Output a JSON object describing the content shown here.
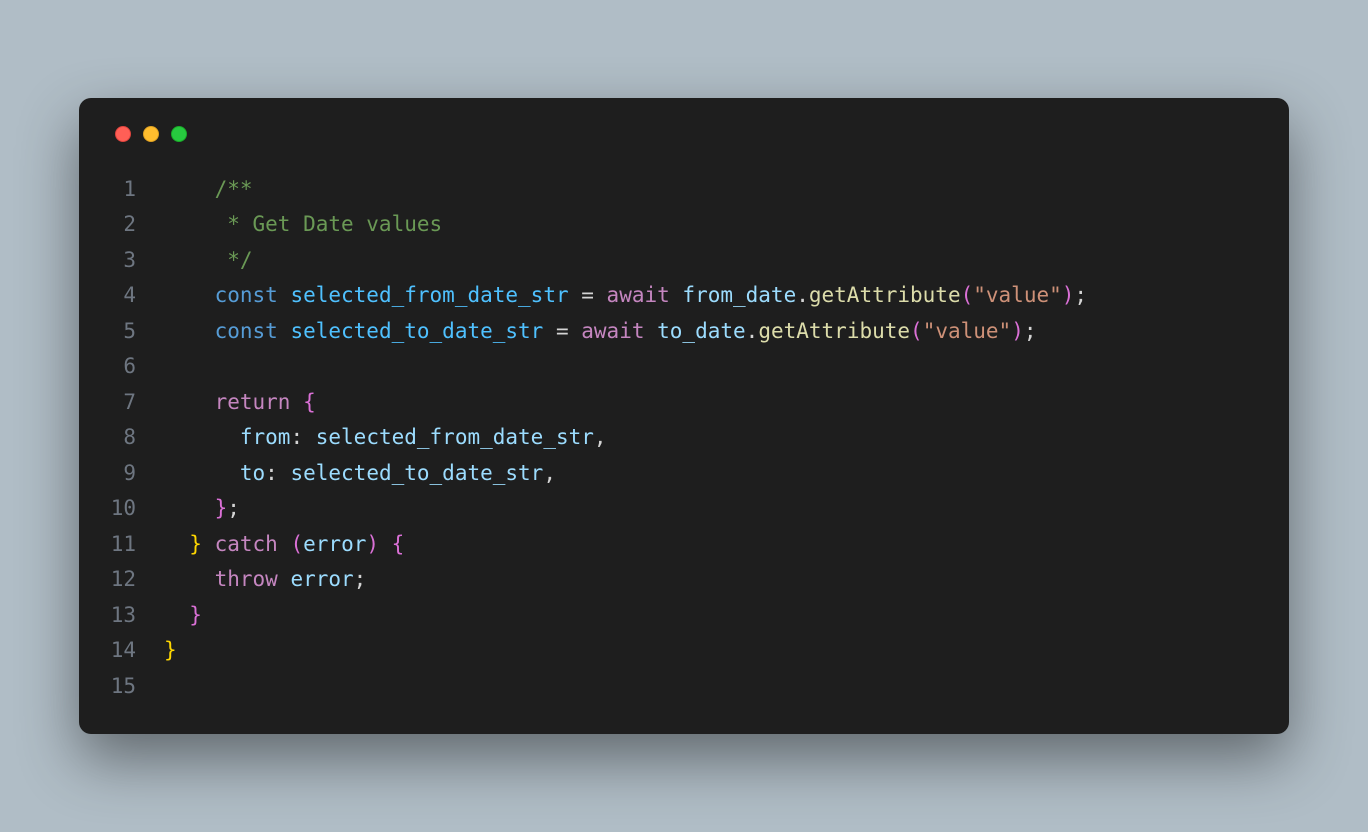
{
  "window": {
    "traffic_lights": [
      "close",
      "minimize",
      "maximize"
    ]
  },
  "code_lines": [
    {
      "n": 1,
      "tokens": [
        {
          "t": "    ",
          "c": "punct"
        },
        {
          "t": "/**",
          "c": "comment"
        }
      ]
    },
    {
      "n": 2,
      "tokens": [
        {
          "t": "     * Get Date values",
          "c": "comment"
        }
      ]
    },
    {
      "n": 3,
      "tokens": [
        {
          "t": "     */",
          "c": "comment"
        }
      ]
    },
    {
      "n": 4,
      "tokens": [
        {
          "t": "    ",
          "c": "punct"
        },
        {
          "t": "const",
          "c": "keyword"
        },
        {
          "t": " ",
          "c": "punct"
        },
        {
          "t": "selected_from_date_str",
          "c": "variable"
        },
        {
          "t": " = ",
          "c": "punct"
        },
        {
          "t": "await",
          "c": "control"
        },
        {
          "t": " ",
          "c": "punct"
        },
        {
          "t": "from_date",
          "c": "identifier"
        },
        {
          "t": ".",
          "c": "punct"
        },
        {
          "t": "getAttribute",
          "c": "function"
        },
        {
          "t": "(",
          "c": "paren1"
        },
        {
          "t": "\"value\"",
          "c": "string"
        },
        {
          "t": ")",
          "c": "paren1"
        },
        {
          "t": ";",
          "c": "punct"
        }
      ]
    },
    {
      "n": 5,
      "tokens": [
        {
          "t": "    ",
          "c": "punct"
        },
        {
          "t": "const",
          "c": "keyword"
        },
        {
          "t": " ",
          "c": "punct"
        },
        {
          "t": "selected_to_date_str",
          "c": "variable"
        },
        {
          "t": " = ",
          "c": "punct"
        },
        {
          "t": "await",
          "c": "control"
        },
        {
          "t": " ",
          "c": "punct"
        },
        {
          "t": "to_date",
          "c": "identifier"
        },
        {
          "t": ".",
          "c": "punct"
        },
        {
          "t": "getAttribute",
          "c": "function"
        },
        {
          "t": "(",
          "c": "paren1"
        },
        {
          "t": "\"value\"",
          "c": "string"
        },
        {
          "t": ")",
          "c": "paren1"
        },
        {
          "t": ";",
          "c": "punct"
        }
      ]
    },
    {
      "n": 6,
      "tokens": [
        {
          "t": "",
          "c": "punct"
        }
      ]
    },
    {
      "n": 7,
      "tokens": [
        {
          "t": "    ",
          "c": "punct"
        },
        {
          "t": "return",
          "c": "control"
        },
        {
          "t": " ",
          "c": "punct"
        },
        {
          "t": "{",
          "c": "paren1"
        }
      ]
    },
    {
      "n": 8,
      "tokens": [
        {
          "t": "      ",
          "c": "punct"
        },
        {
          "t": "from",
          "c": "identifier"
        },
        {
          "t": ":",
          "c": "punct"
        },
        {
          "t": " ",
          "c": "punct"
        },
        {
          "t": "selected_from_date_str",
          "c": "identifier"
        },
        {
          "t": ",",
          "c": "punct"
        }
      ]
    },
    {
      "n": 9,
      "tokens": [
        {
          "t": "      ",
          "c": "punct"
        },
        {
          "t": "to",
          "c": "identifier"
        },
        {
          "t": ":",
          "c": "punct"
        },
        {
          "t": " ",
          "c": "punct"
        },
        {
          "t": "selected_to_date_str",
          "c": "identifier"
        },
        {
          "t": ",",
          "c": "punct"
        }
      ]
    },
    {
      "n": 10,
      "tokens": [
        {
          "t": "    ",
          "c": "punct"
        },
        {
          "t": "}",
          "c": "paren1"
        },
        {
          "t": ";",
          "c": "punct"
        }
      ]
    },
    {
      "n": 11,
      "tokens": [
        {
          "t": "  ",
          "c": "punct"
        },
        {
          "t": "}",
          "c": "brace"
        },
        {
          "t": " ",
          "c": "punct"
        },
        {
          "t": "catch",
          "c": "control"
        },
        {
          "t": " ",
          "c": "punct"
        },
        {
          "t": "(",
          "c": "paren1"
        },
        {
          "t": "error",
          "c": "identifier"
        },
        {
          "t": ")",
          "c": "paren1"
        },
        {
          "t": " ",
          "c": "punct"
        },
        {
          "t": "{",
          "c": "paren1"
        }
      ]
    },
    {
      "n": 12,
      "tokens": [
        {
          "t": "    ",
          "c": "punct"
        },
        {
          "t": "throw",
          "c": "control"
        },
        {
          "t": " ",
          "c": "punct"
        },
        {
          "t": "error",
          "c": "identifier"
        },
        {
          "t": ";",
          "c": "punct"
        }
      ]
    },
    {
      "n": 13,
      "tokens": [
        {
          "t": "  ",
          "c": "punct"
        },
        {
          "t": "}",
          "c": "paren1"
        }
      ]
    },
    {
      "n": 14,
      "tokens": [
        {
          "t": "}",
          "c": "brace"
        }
      ]
    },
    {
      "n": 15,
      "tokens": [
        {
          "t": "",
          "c": "punct"
        }
      ]
    }
  ]
}
